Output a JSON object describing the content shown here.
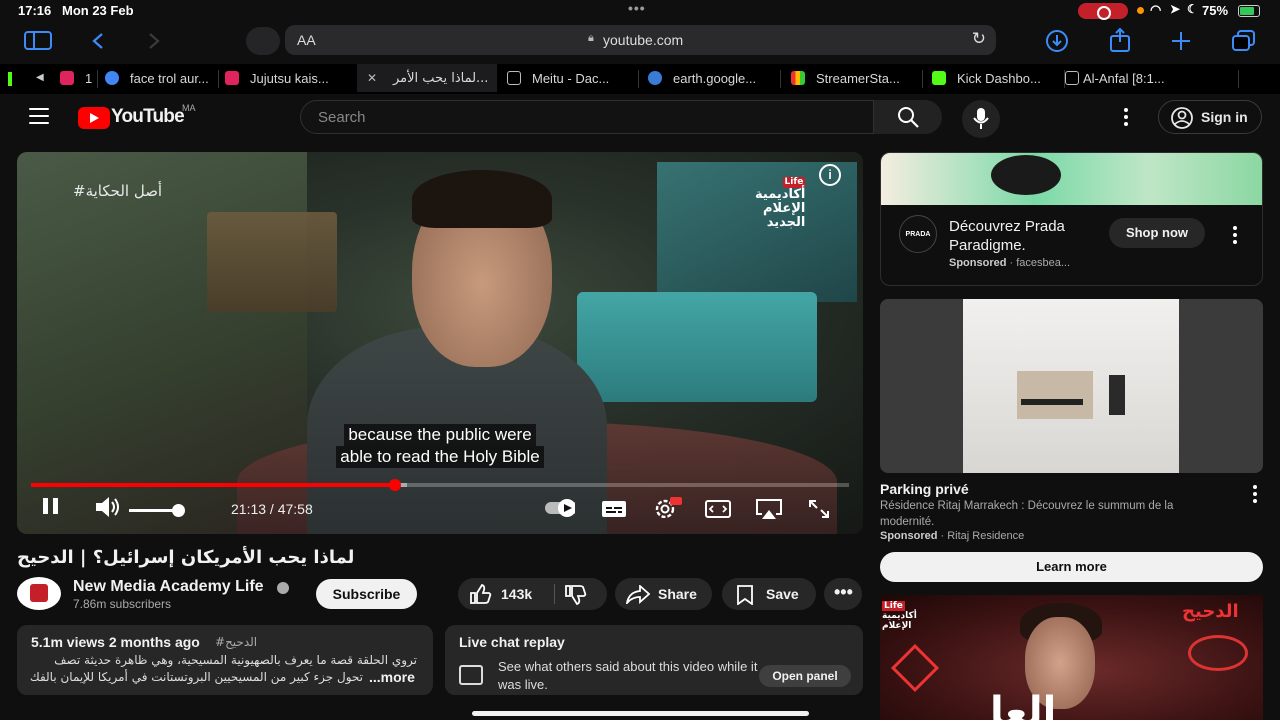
{
  "status": {
    "time": "17:16",
    "date": "Mon 23 Feb",
    "battery": "75%"
  },
  "safari": {
    "text_size": "AA",
    "url": "youtube.com"
  },
  "tabs": [
    {
      "label": "1",
      "fav": "#e0245e"
    },
    {
      "label": "face trol aur...",
      "fav": "#4285f4"
    },
    {
      "label": "Jujutsu kais...",
      "fav": "#e0245e"
    },
    {
      "label": "لماذا يحب الأمر...",
      "fav": "#555555"
    },
    {
      "label": "Meitu - Dac...",
      "fav": "#555555"
    },
    {
      "label": "earth.google...",
      "fav": "#3a7bd5"
    },
    {
      "label": "StreamerSta...",
      "fav": "#f5a623"
    },
    {
      "label": "Kick Dashbo...",
      "fav": "#53fc18"
    },
    {
      "label": "Al-Anfal [8:1...",
      "fav": "#555555"
    }
  ],
  "youtube": {
    "logo": "YouTube",
    "country": "MA",
    "search_placeholder": "Search",
    "sign_in": "Sign in"
  },
  "player": {
    "overlay_tag": "#أصل الحكاية",
    "brand_line1": "Life",
    "brand_line2": "أكاديمية",
    "brand_line3": "الإعلام",
    "brand_line4": "الجديد",
    "caption_line1": "because the public were",
    "caption_line2": "able to read the Holy Bible",
    "time": "21:13 / 47:58",
    "progress_played": 0.445,
    "progress_loaded": 0.46,
    "volume": 1.0
  },
  "video": {
    "title": "لماذا يحب الأمريكان إسرائيل؟ | الدحيح",
    "channel": "New Media Academy Life",
    "subscribers": "7.86m subscribers",
    "subscribe": "Subscribe",
    "likes": "143k",
    "share": "Share",
    "save": "Save"
  },
  "description": {
    "stats": "5.1m views  2 months ago",
    "hashtag": "#الدحيح",
    "line1": "تروي الحلقة قصة ما يعرف بالصهيونية المسيحية، وهي ظاهرة حديثة تصف",
    "line2": "تحول جزء كبير من المسيحيين البروتستانت في أمريكا للإيمان بالفك",
    "more": "...more"
  },
  "chat": {
    "title": "Live chat replay",
    "text": "See what others said about this video while it was live.",
    "open": "Open panel"
  },
  "ad1": {
    "logo": "PRADA",
    "title": "Découvrez Prada Paradigme.",
    "sponsored": "Sponsored",
    "source": "· facesbea...",
    "cta": "Shop now"
  },
  "ad2": {
    "title": "Parking privé",
    "desc": "Résidence Ritaj Marrakech : Découvrez le summum de la modernité.",
    "sponsored": "Sponsored",
    "source": "· Ritaj Residence",
    "cta": "Learn more"
  },
  "thumb3": {
    "title": "الدحيح",
    "logo1": "Life",
    "logo2": "أكاديمية",
    "logo3": "الإعلام",
    "big": "العا"
  }
}
